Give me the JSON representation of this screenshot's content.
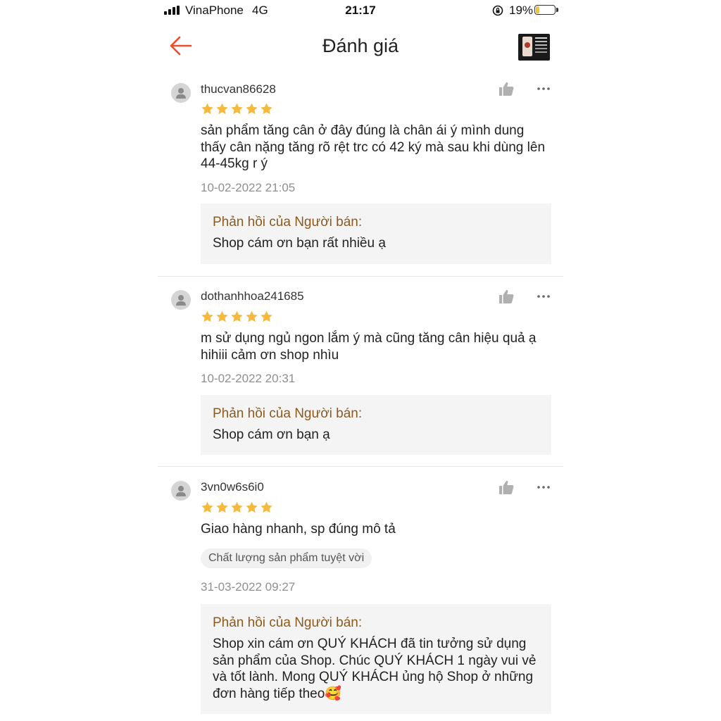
{
  "status_bar": {
    "carrier": "VinaPhone",
    "network": "4G",
    "time": "21:17",
    "battery_percent_label": "19%",
    "battery_level": 0.19
  },
  "header": {
    "title": "Đánh giá",
    "back_icon": "arrow-left-icon",
    "accent_color": "#ee4d2d"
  },
  "reviews": [
    {
      "username": "thucvan86628",
      "rating": 5,
      "text": "sản phẩm tăng cân ở đây đúng là chân ái ý mình dung thấy cân nặng tăng rõ rệt trc có 42 ký mà sau khi dùng lên 44-45kg r ý",
      "date": "10-02-2022 21:05",
      "reply_title": "Phản hồi của Người bán:",
      "reply_text": "Shop cám ơn bạn rất nhiều ạ"
    },
    {
      "username": "dothanhhoa241685",
      "rating": 5,
      "text": "m sử dụng ngủ ngon lắm ý mà cũng tăng cân  hiệu quả ạ hihiii cảm ơn shop nhìu",
      "date": "10-02-2022 20:31",
      "reply_title": "Phản hồi của Người bán:",
      "reply_text": "Shop cám ơn bạn ạ"
    },
    {
      "username": "3vn0w6s6i0",
      "rating": 5,
      "text": "Giao hàng nhanh, sp đúng mô tả",
      "tag": "Chất lượng sản phẩm tuyệt vời",
      "date": "31-03-2022 09:27",
      "reply_title": "Phản hồi của Người bán:",
      "reply_text": "Shop xin cám ơn QUÝ KHÁCH đã tin tưởng sử dụng sản phẩm của Shop. Chúc QUÝ KHÁCH 1 ngày vui vẻ và tốt lành. Mong QUÝ KHÁCH ủng hộ Shop ở những đơn hàng tiếp theo🥰"
    }
  ],
  "colors": {
    "star": "#f6b93b",
    "reply_title": "#8a5a1f",
    "date": "#8f8f8f",
    "icon_gray": "#b0b0b0"
  }
}
